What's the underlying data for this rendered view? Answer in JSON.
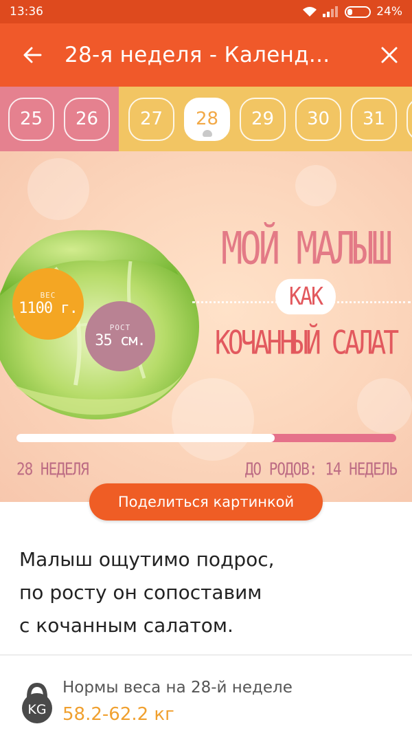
{
  "status_bar": {
    "time": "13:36",
    "battery": "24%"
  },
  "app_bar": {
    "title": "28-я неделя - Календ...",
    "back_icon": "arrow-left-icon",
    "close_icon": "close-icon"
  },
  "weeks": {
    "past": [
      "25",
      "26"
    ],
    "current": "28",
    "future": [
      "27",
      "28",
      "29",
      "30",
      "31"
    ]
  },
  "hero": {
    "weight_label": "ВЕС",
    "weight_value": "1100 г.",
    "height_label": "РОСТ",
    "height_value": "35 см.",
    "line1": "МОЙ МАЛЫШ",
    "line2": "КАК",
    "line3": "КОЧАННЫЙ САЛАТ",
    "progress_fraction": 0.68,
    "week_label": "28 НЕДЕЛЯ",
    "remaining_label": "ДО РОДОВ: 14 НЕДЕЛЬ"
  },
  "share_button": "Поделиться картинкой",
  "description": [
    "Малыш ощутимо подрос,",
    "по росту он сопоставим",
    "с кочанным салатом."
  ],
  "norm": {
    "icon_text": "KG",
    "title": "Нормы веса на 28-й неделе",
    "value": "58.2-62.2 кг"
  },
  "colors": {
    "status_bar": "#de4a1e",
    "app_bar": "#f0592a",
    "past_weeks_bg": "#e5818f",
    "future_weeks_bg": "#f2c563",
    "accent_orange": "#f0a02f",
    "headline_pink": "#e37a86",
    "share_button": "#ef5d25"
  }
}
